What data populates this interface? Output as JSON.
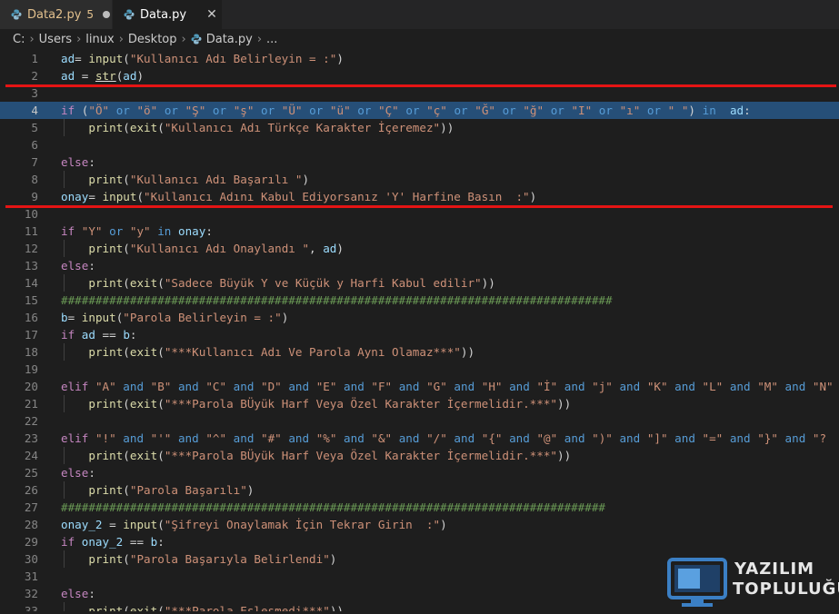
{
  "tabs": [
    {
      "name": "Data2.py",
      "problems": "5",
      "modified": true,
      "active": false
    },
    {
      "name": "Data.py",
      "active": true,
      "close": "✕"
    }
  ],
  "breadcrumb": [
    "C:",
    "Users",
    "linux",
    "Desktop",
    "Data.py",
    "..."
  ],
  "lines": [
    {
      "n": "1",
      "code": "ad= input(\"Kullanıcı Adı Belirleyin = :\")"
    },
    {
      "n": "2",
      "code": "ad = str(ad)"
    },
    {
      "n": "3",
      "code": ""
    },
    {
      "n": "4",
      "code": "if (\"Ö\" or \"ö\" or \"Ş\" or \"ş\" or \"Ü\" or \"ü\" or \"Ç\" or \"ç\" or \"Ğ\" or \"ğ\" or \"I\" or \"ı\" or \" \") in  ad:"
    },
    {
      "n": "5",
      "code": "    print(exit(\"Kullanıcı Adı Türkçe Karakter İçeremez\"))"
    },
    {
      "n": "6",
      "code": ""
    },
    {
      "n": "7",
      "code": "else:"
    },
    {
      "n": "8",
      "code": "    print(\"Kullanıcı Adı Başarılı \")"
    },
    {
      "n": "9",
      "code": "onay= input(\"Kullanıcı Adını Kabul Ediyorsanız 'Y' Harfine Basın  :\")"
    },
    {
      "n": "10",
      "code": ""
    },
    {
      "n": "11",
      "code": "if \"Y\" or \"y\" in onay:"
    },
    {
      "n": "12",
      "code": "    print(\"Kullanıcı Adı Onaylandı \", ad)"
    },
    {
      "n": "13",
      "code": "else:"
    },
    {
      "n": "14",
      "code": "    print(exit(\"Sadece Büyük Y ve Küçük y Harfi Kabul edilir\"))"
    },
    {
      "n": "15",
      "code": "################################################################################"
    },
    {
      "n": "16",
      "code": "b= input(\"Parola Belirleyin = :\")"
    },
    {
      "n": "17",
      "code": "if ad == b:"
    },
    {
      "n": "18",
      "code": "    print(exit(\"***Kullanıcı Adı Ve Parola Aynı Olamaz***\"))"
    },
    {
      "n": "19",
      "code": ""
    },
    {
      "n": "20",
      "code": "elif \"A\" and \"B\" and \"C\" and \"D\" and \"E\" and \"F\" and \"G\" and \"H\" and \"İ\" and \"j\" and \"K\" and \"L\" and \"M\" and \"N\""
    },
    {
      "n": "21",
      "code": "    print(exit(\"***Parola BÜyük Harf Veya Özel Karakter İçermelidir.***\"))"
    },
    {
      "n": "22",
      "code": ""
    },
    {
      "n": "23",
      "code": "elif \"!\" and \"'\" and \"^\" and \"#\" and \"%\" and \"&\" and \"/\" and \"{\" and \"@\" and \")\" and \"]\" and \"=\" and \"}\" and \"?"
    },
    {
      "n": "24",
      "code": "    print(exit(\"***Parola BÜyük Harf Veya Özel Karakter İçermelidir.***\"))"
    },
    {
      "n": "25",
      "code": "else:"
    },
    {
      "n": "26",
      "code": "    print(\"Parola Başarılı\")"
    },
    {
      "n": "27",
      "code": "###############################################################################"
    },
    {
      "n": "28",
      "code": "onay_2 = input(\"Şifreyi Onaylamak İçin Tekrar Girin  :\")"
    },
    {
      "n": "29",
      "code": "if onay_2 == b:"
    },
    {
      "n": "30",
      "code": "    print(\"Parola Başarıyla Belirlendi\")"
    },
    {
      "n": "31",
      "code": ""
    },
    {
      "n": "32",
      "code": "else:"
    },
    {
      "n": "33",
      "code": "    print(exit(\"***Parola Eşleşmedi***\"))"
    }
  ],
  "watermark": {
    "line1": "YAZILIM",
    "line2": "TOPLULUĞU"
  },
  "colors": {
    "accent_red": "#e51414",
    "selection": "#264f78",
    "modified": "#e2c08d"
  }
}
